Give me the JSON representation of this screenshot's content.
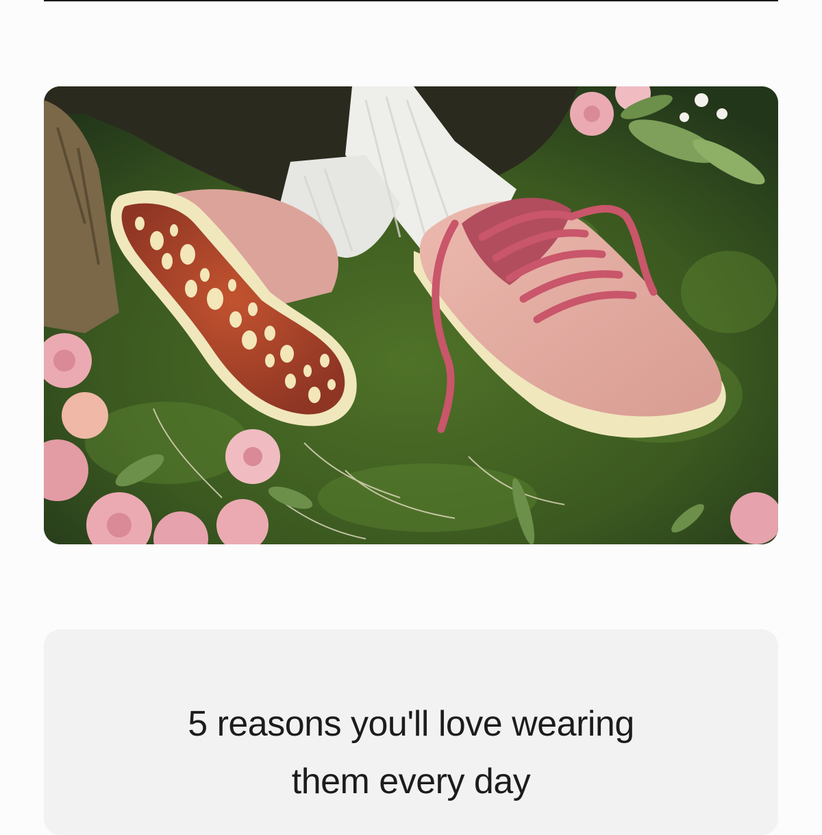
{
  "hero": {
    "image_subject": "pink-knit-sneakers-on-moss-with-roses",
    "colors": {
      "moss": "#3d5a22",
      "shoe_pink": "#e2aaa0",
      "laces": "#c9566a",
      "sole": "#f0e7bd",
      "outsole": "#a3422e",
      "sock": "#eeeeea",
      "trousers": "#2b2a1f",
      "rose": "#ebaab2"
    }
  },
  "feature_card": {
    "headline_line1": "5 reasons you'll love wearing",
    "headline_line2": "them every day",
    "background": "#f2f2f2"
  }
}
